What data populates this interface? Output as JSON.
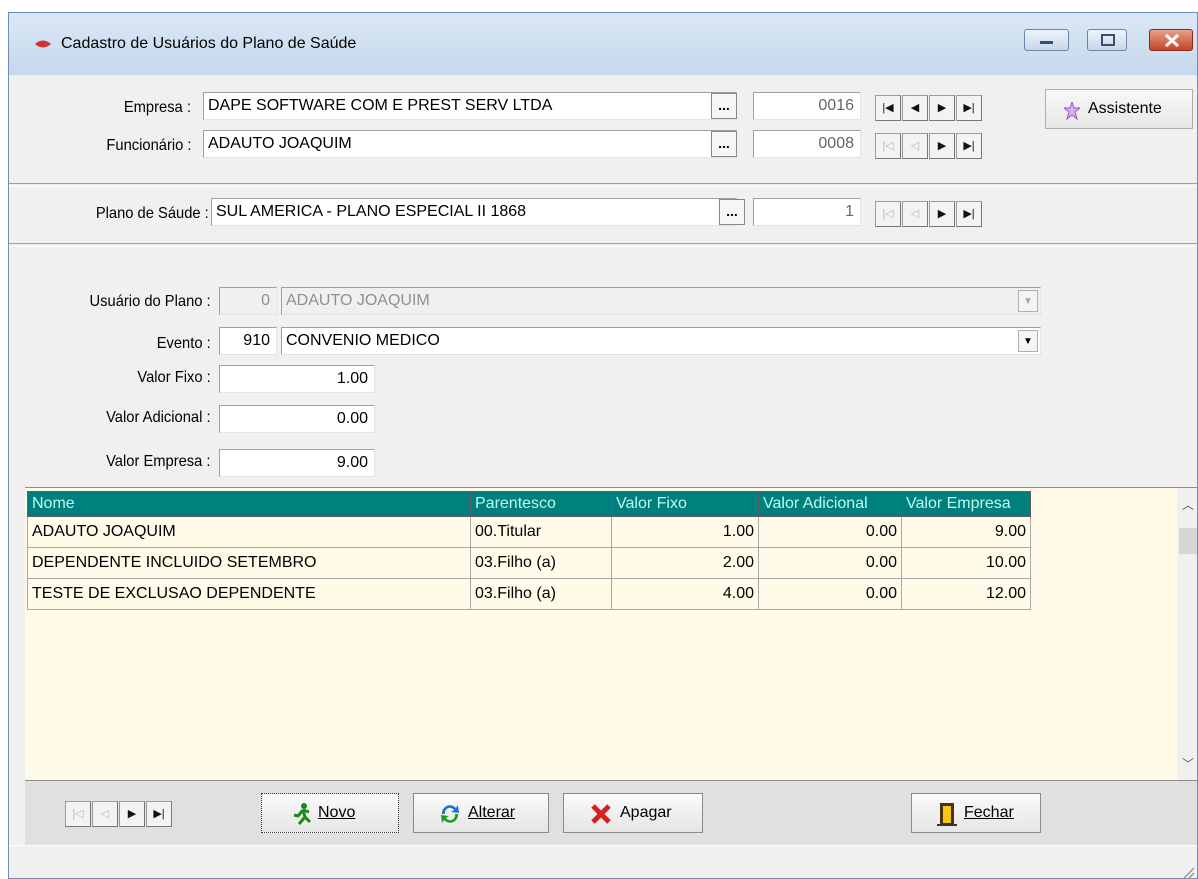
{
  "window": {
    "title": "Cadastro de Usuários do Plano de Saúde"
  },
  "header": {
    "empresa": {
      "label": "Empresa :",
      "value": "DAPE SOFTWARE COM E PREST SERV LTDA",
      "code": "0016"
    },
    "funcionario": {
      "label": "Funcionário :",
      "value": "ADAUTO JOAQUIM",
      "code": "0008"
    },
    "plano": {
      "label": "Plano de Sáude :",
      "value": "SUL AMERICA - PLANO ESPECIAL II 1868",
      "code": "1"
    },
    "ellipsis": "...",
    "assistant_button": "Assistente"
  },
  "form": {
    "usuario": {
      "label": "Usuário do Plano :",
      "code": "0",
      "value": "ADAUTO JOAQUIM"
    },
    "evento": {
      "label": "Evento :",
      "code": "910",
      "value": "CONVENIO MEDICO"
    },
    "valor_fixo": {
      "label": "Valor Fixo :",
      "value": "1.00"
    },
    "valor_adicional": {
      "label": "Valor Adicional :",
      "value": "0.00"
    },
    "valor_empresa": {
      "label": "Valor Empresa :",
      "value": "9.00"
    }
  },
  "grid": {
    "columns": [
      "Nome",
      "Parentesco",
      "Valor Fixo",
      "Valor Adicional",
      "Valor Empresa"
    ],
    "rows": [
      [
        "ADAUTO JOAQUIM",
        "00.Titular",
        "1.00",
        "0.00",
        "9.00"
      ],
      [
        "DEPENDENTE INCLUIDO SETEMBRO",
        "03.Filho (a)",
        "2.00",
        "0.00",
        "10.00"
      ],
      [
        "TESTE DE EXCLUSAO DEPENDENTE",
        "03.Filho (a)",
        "4.00",
        "0.00",
        "12.00"
      ]
    ]
  },
  "toolbar": {
    "novo": "Novo",
    "alterar": "Alterar",
    "apagar": "Apagar",
    "fechar": "Fechar"
  },
  "colors": {
    "grid_header_bg": "#007f7f",
    "grid_header_text": "#bdfaf0",
    "grid_bg": "#fffbe8"
  }
}
